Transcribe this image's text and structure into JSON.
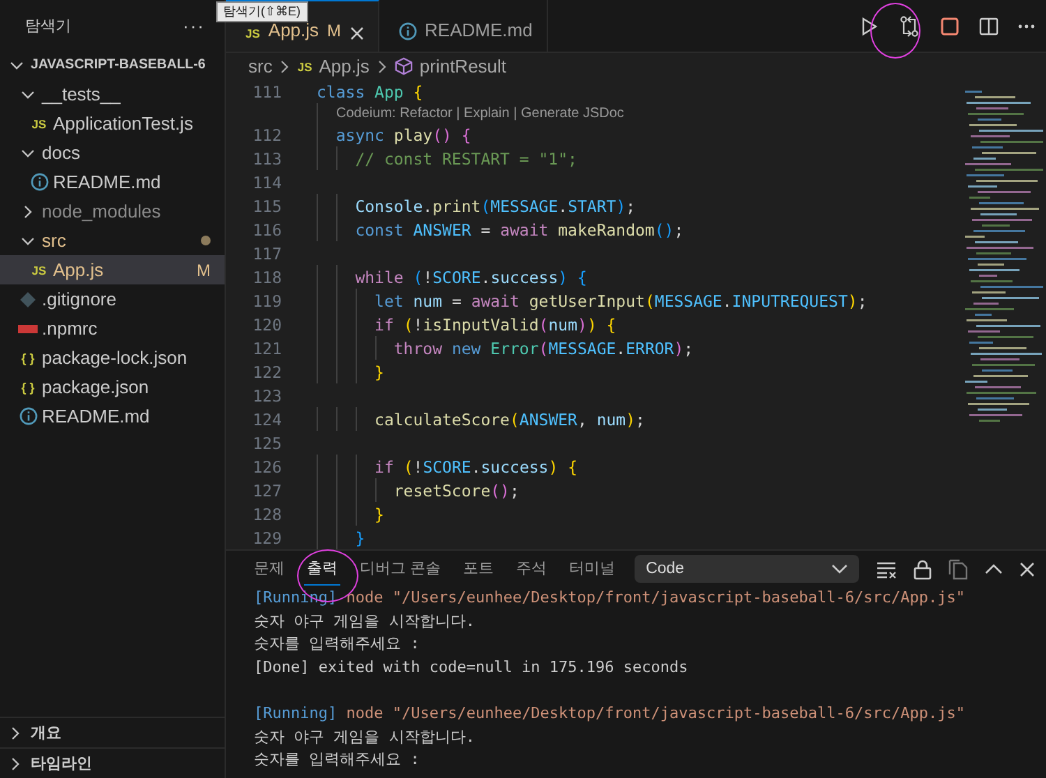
{
  "sidebar": {
    "title": "탐색기",
    "more": "···",
    "tree": [
      {
        "name": "JAVASCRIPT-BASEBALL-6",
        "kind": "root",
        "expanded": true,
        "children": [
          {
            "name": "__tests__",
            "kind": "folder",
            "expanded": true,
            "children": [
              {
                "name": "ApplicationTest.js",
                "kind": "js",
                "icon_label": "JS"
              }
            ]
          },
          {
            "name": "docs",
            "kind": "folder",
            "expanded": true,
            "children": [
              {
                "name": "README.md",
                "kind": "info"
              }
            ]
          },
          {
            "name": "node_modules",
            "kind": "folder",
            "expanded": false,
            "ignored": true
          },
          {
            "name": "src",
            "kind": "folder",
            "expanded": true,
            "modified": true,
            "children": [
              {
                "name": "App.js",
                "kind": "js",
                "icon_label": "JS",
                "modified": true,
                "badge": "M",
                "selected": true
              }
            ]
          },
          {
            "name": ".gitignore",
            "kind": "git"
          },
          {
            "name": ".npmrc",
            "kind": "npm"
          },
          {
            "name": "package-lock.json",
            "kind": "json",
            "icon_label": "{ }"
          },
          {
            "name": "package.json",
            "kind": "json",
            "icon_label": "{ }"
          },
          {
            "name": "README.md",
            "kind": "info"
          }
        ]
      }
    ],
    "sections": [
      {
        "label": "개요",
        "expanded": false
      },
      {
        "label": "타임라인",
        "expanded": false
      }
    ]
  },
  "tooltip": {
    "text": "탐색기(⇧⌘E)"
  },
  "tabs": [
    {
      "label": "App.js",
      "kind": "js",
      "icon_label": "JS",
      "badge": "M",
      "modified": true,
      "selected": true
    },
    {
      "label": "README.md",
      "kind": "info",
      "selected": false
    }
  ],
  "breadcrumbs": [
    {
      "label": "src",
      "kind": "folder"
    },
    {
      "label": "App.js",
      "kind": "js",
      "icon_label": "JS"
    },
    {
      "label": "printResult",
      "kind": "method"
    }
  ],
  "code": [
    {
      "kind": "code",
      "number": "111",
      "tokens": [
        {
          "text": "class ",
          "kind": "keyword"
        },
        {
          "text": "App ",
          "kind": "class"
        },
        {
          "text": "{",
          "kind": "bracket1"
        }
      ]
    },
    {
      "kind": "codelens",
      "text": "Codeium: Refactor | Explain | Generate JSDoc"
    },
    {
      "kind": "code",
      "number": "112",
      "tokens": [
        {
          "text": "  async ",
          "kind": "keyword"
        },
        {
          "text": "play",
          "kind": "function"
        },
        {
          "text": "() {",
          "kind": "bracket2"
        }
      ]
    },
    {
      "kind": "code",
      "number": "113",
      "tokens": [
        {
          "text": "    // const RESTART = \"1\";",
          "kind": "comment"
        }
      ]
    },
    {
      "kind": "code",
      "number": "114"
    },
    {
      "kind": "code",
      "number": "115",
      "tokens": [
        {
          "text": "    Console",
          "kind": "variable"
        },
        {
          "text": ".",
          "kind": "plain"
        },
        {
          "text": "print",
          "kind": "function"
        },
        {
          "text": "(",
          "kind": "bracket3"
        },
        {
          "text": "MESSAGE",
          "kind": "constant"
        },
        {
          "text": ".",
          "kind": "plain"
        },
        {
          "text": "START",
          "kind": "constant"
        },
        {
          "text": ")",
          "kind": "bracket3"
        },
        {
          "text": ";",
          "kind": "plain"
        }
      ]
    },
    {
      "kind": "code",
      "number": "116",
      "tokens": [
        {
          "text": "    const ",
          "kind": "keyword"
        },
        {
          "text": "ANSWER",
          "kind": "constant"
        },
        {
          "text": " = ",
          "kind": "plain"
        },
        {
          "text": "await ",
          "kind": "control"
        },
        {
          "text": "makeRandom",
          "kind": "function"
        },
        {
          "text": "()",
          "kind": "bracket3"
        },
        {
          "text": ";",
          "kind": "plain"
        }
      ]
    },
    {
      "kind": "code",
      "number": "117"
    },
    {
      "kind": "code",
      "number": "118",
      "tokens": [
        {
          "text": "    while ",
          "kind": "control"
        },
        {
          "text": "(",
          "kind": "bracket3"
        },
        {
          "text": "!",
          "kind": "plain"
        },
        {
          "text": "SCORE",
          "kind": "constant"
        },
        {
          "text": ".",
          "kind": "plain"
        },
        {
          "text": "success",
          "kind": "variable"
        },
        {
          "text": ") {",
          "kind": "bracket3"
        }
      ]
    },
    {
      "kind": "code",
      "number": "119",
      "tokens": [
        {
          "text": "      let ",
          "kind": "keyword"
        },
        {
          "text": "num",
          "kind": "variable"
        },
        {
          "text": " = ",
          "kind": "plain"
        },
        {
          "text": "await ",
          "kind": "control"
        },
        {
          "text": "getUserInput",
          "kind": "function"
        },
        {
          "text": "(",
          "kind": "bracket1"
        },
        {
          "text": "MESSAGE",
          "kind": "constant"
        },
        {
          "text": ".",
          "kind": "plain"
        },
        {
          "text": "INPUTREQUEST",
          "kind": "constant"
        },
        {
          "text": ")",
          "kind": "bracket1"
        },
        {
          "text": ";",
          "kind": "plain"
        }
      ]
    },
    {
      "kind": "code",
      "number": "120",
      "tokens": [
        {
          "text": "      if ",
          "kind": "control"
        },
        {
          "text": "(",
          "kind": "bracket1"
        },
        {
          "text": "!",
          "kind": "plain"
        },
        {
          "text": "isInputValid",
          "kind": "function"
        },
        {
          "text": "(",
          "kind": "bracket2"
        },
        {
          "text": "num",
          "kind": "variable"
        },
        {
          "text": ")",
          "kind": "bracket2"
        },
        {
          "text": ") {",
          "kind": "bracket1"
        }
      ]
    },
    {
      "kind": "code",
      "number": "121",
      "tokens": [
        {
          "text": "        throw ",
          "kind": "control"
        },
        {
          "text": "new ",
          "kind": "keyword"
        },
        {
          "text": "Error",
          "kind": "class"
        },
        {
          "text": "(",
          "kind": "bracket2"
        },
        {
          "text": "MESSAGE",
          "kind": "constant"
        },
        {
          "text": ".",
          "kind": "plain"
        },
        {
          "text": "ERROR",
          "kind": "constant"
        },
        {
          "text": ")",
          "kind": "bracket2"
        },
        {
          "text": ";",
          "kind": "plain"
        }
      ]
    },
    {
      "kind": "code",
      "number": "122",
      "tokens": [
        {
          "text": "      }",
          "kind": "bracket1"
        }
      ]
    },
    {
      "kind": "code",
      "number": "123"
    },
    {
      "kind": "code",
      "number": "124",
      "tokens": [
        {
          "text": "      calculateScore",
          "kind": "function"
        },
        {
          "text": "(",
          "kind": "bracket1"
        },
        {
          "text": "ANSWER",
          "kind": "constant"
        },
        {
          "text": ", ",
          "kind": "plain"
        },
        {
          "text": "num",
          "kind": "variable"
        },
        {
          "text": ")",
          "kind": "bracket1"
        },
        {
          "text": ";",
          "kind": "plain"
        }
      ]
    },
    {
      "kind": "code",
      "number": "125"
    },
    {
      "kind": "code",
      "number": "126",
      "tokens": [
        {
          "text": "      if ",
          "kind": "control"
        },
        {
          "text": "(",
          "kind": "bracket1"
        },
        {
          "text": "!",
          "kind": "plain"
        },
        {
          "text": "SCORE",
          "kind": "constant"
        },
        {
          "text": ".",
          "kind": "plain"
        },
        {
          "text": "success",
          "kind": "variable"
        },
        {
          "text": ") {",
          "kind": "bracket1"
        }
      ]
    },
    {
      "kind": "code",
      "number": "127",
      "tokens": [
        {
          "text": "        resetScore",
          "kind": "function"
        },
        {
          "text": "()",
          "kind": "bracket2"
        },
        {
          "text": ";",
          "kind": "plain"
        }
      ]
    },
    {
      "kind": "code",
      "number": "128",
      "tokens": [
        {
          "text": "      }",
          "kind": "bracket1"
        }
      ]
    },
    {
      "kind": "code",
      "number": "129",
      "tokens": [
        {
          "text": "    }",
          "kind": "bracket3"
        }
      ]
    }
  ],
  "panel": {
    "tabs": [
      {
        "label": "문제",
        "selected": false
      },
      {
        "label": "출력",
        "selected": true
      },
      {
        "label": "디버그 콘솔",
        "selected": false
      },
      {
        "label": "포트",
        "selected": false
      },
      {
        "label": "주석",
        "selected": false
      },
      {
        "label": "터미널",
        "selected": false
      }
    ],
    "channel": "Code",
    "output": [
      {
        "kind": "running",
        "tag": "[Running]",
        "text": "node \"/Users/eunhee/Desktop/front/javascript-baseball-6/src/App.js\""
      },
      {
        "kind": "text",
        "text": "숫자 야구 게임을 시작합니다."
      },
      {
        "kind": "text",
        "text": "숫자를 입력해주세요 :"
      },
      {
        "kind": "text",
        "text": "[Done] exited with code=null in 175.196 seconds"
      },
      {
        "kind": "blank"
      },
      {
        "kind": "running",
        "tag": "[Running]",
        "text": "node \"/Users/eunhee/Desktop/front/javascript-baseball-6/src/App.js\""
      },
      {
        "kind": "text",
        "text": "숫자 야구 게임을 시작합니다."
      },
      {
        "kind": "text",
        "text": "숫자를 입력해주세요 :"
      }
    ]
  }
}
